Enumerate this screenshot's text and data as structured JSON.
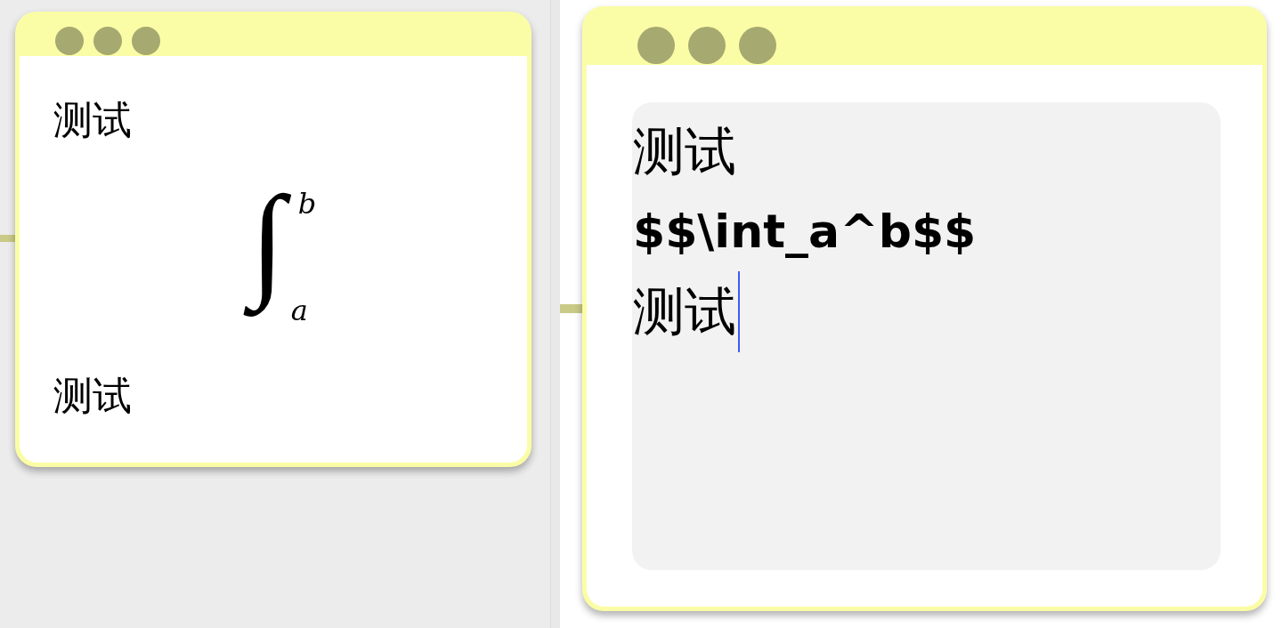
{
  "preview_card": {
    "blocks": [
      {
        "kind": "text",
        "text": "测试"
      },
      {
        "kind": "integral",
        "operator": "∫",
        "lower": "a",
        "upper": "b"
      },
      {
        "kind": "text",
        "text": "测试"
      }
    ]
  },
  "editor_card": {
    "field": {
      "focused": true,
      "lines": [
        {
          "kind": "text",
          "text": "测试"
        },
        {
          "kind": "formula",
          "text": "$$\\int_a^b$$"
        },
        {
          "kind": "text",
          "text": "测试"
        }
      ]
    }
  }
}
